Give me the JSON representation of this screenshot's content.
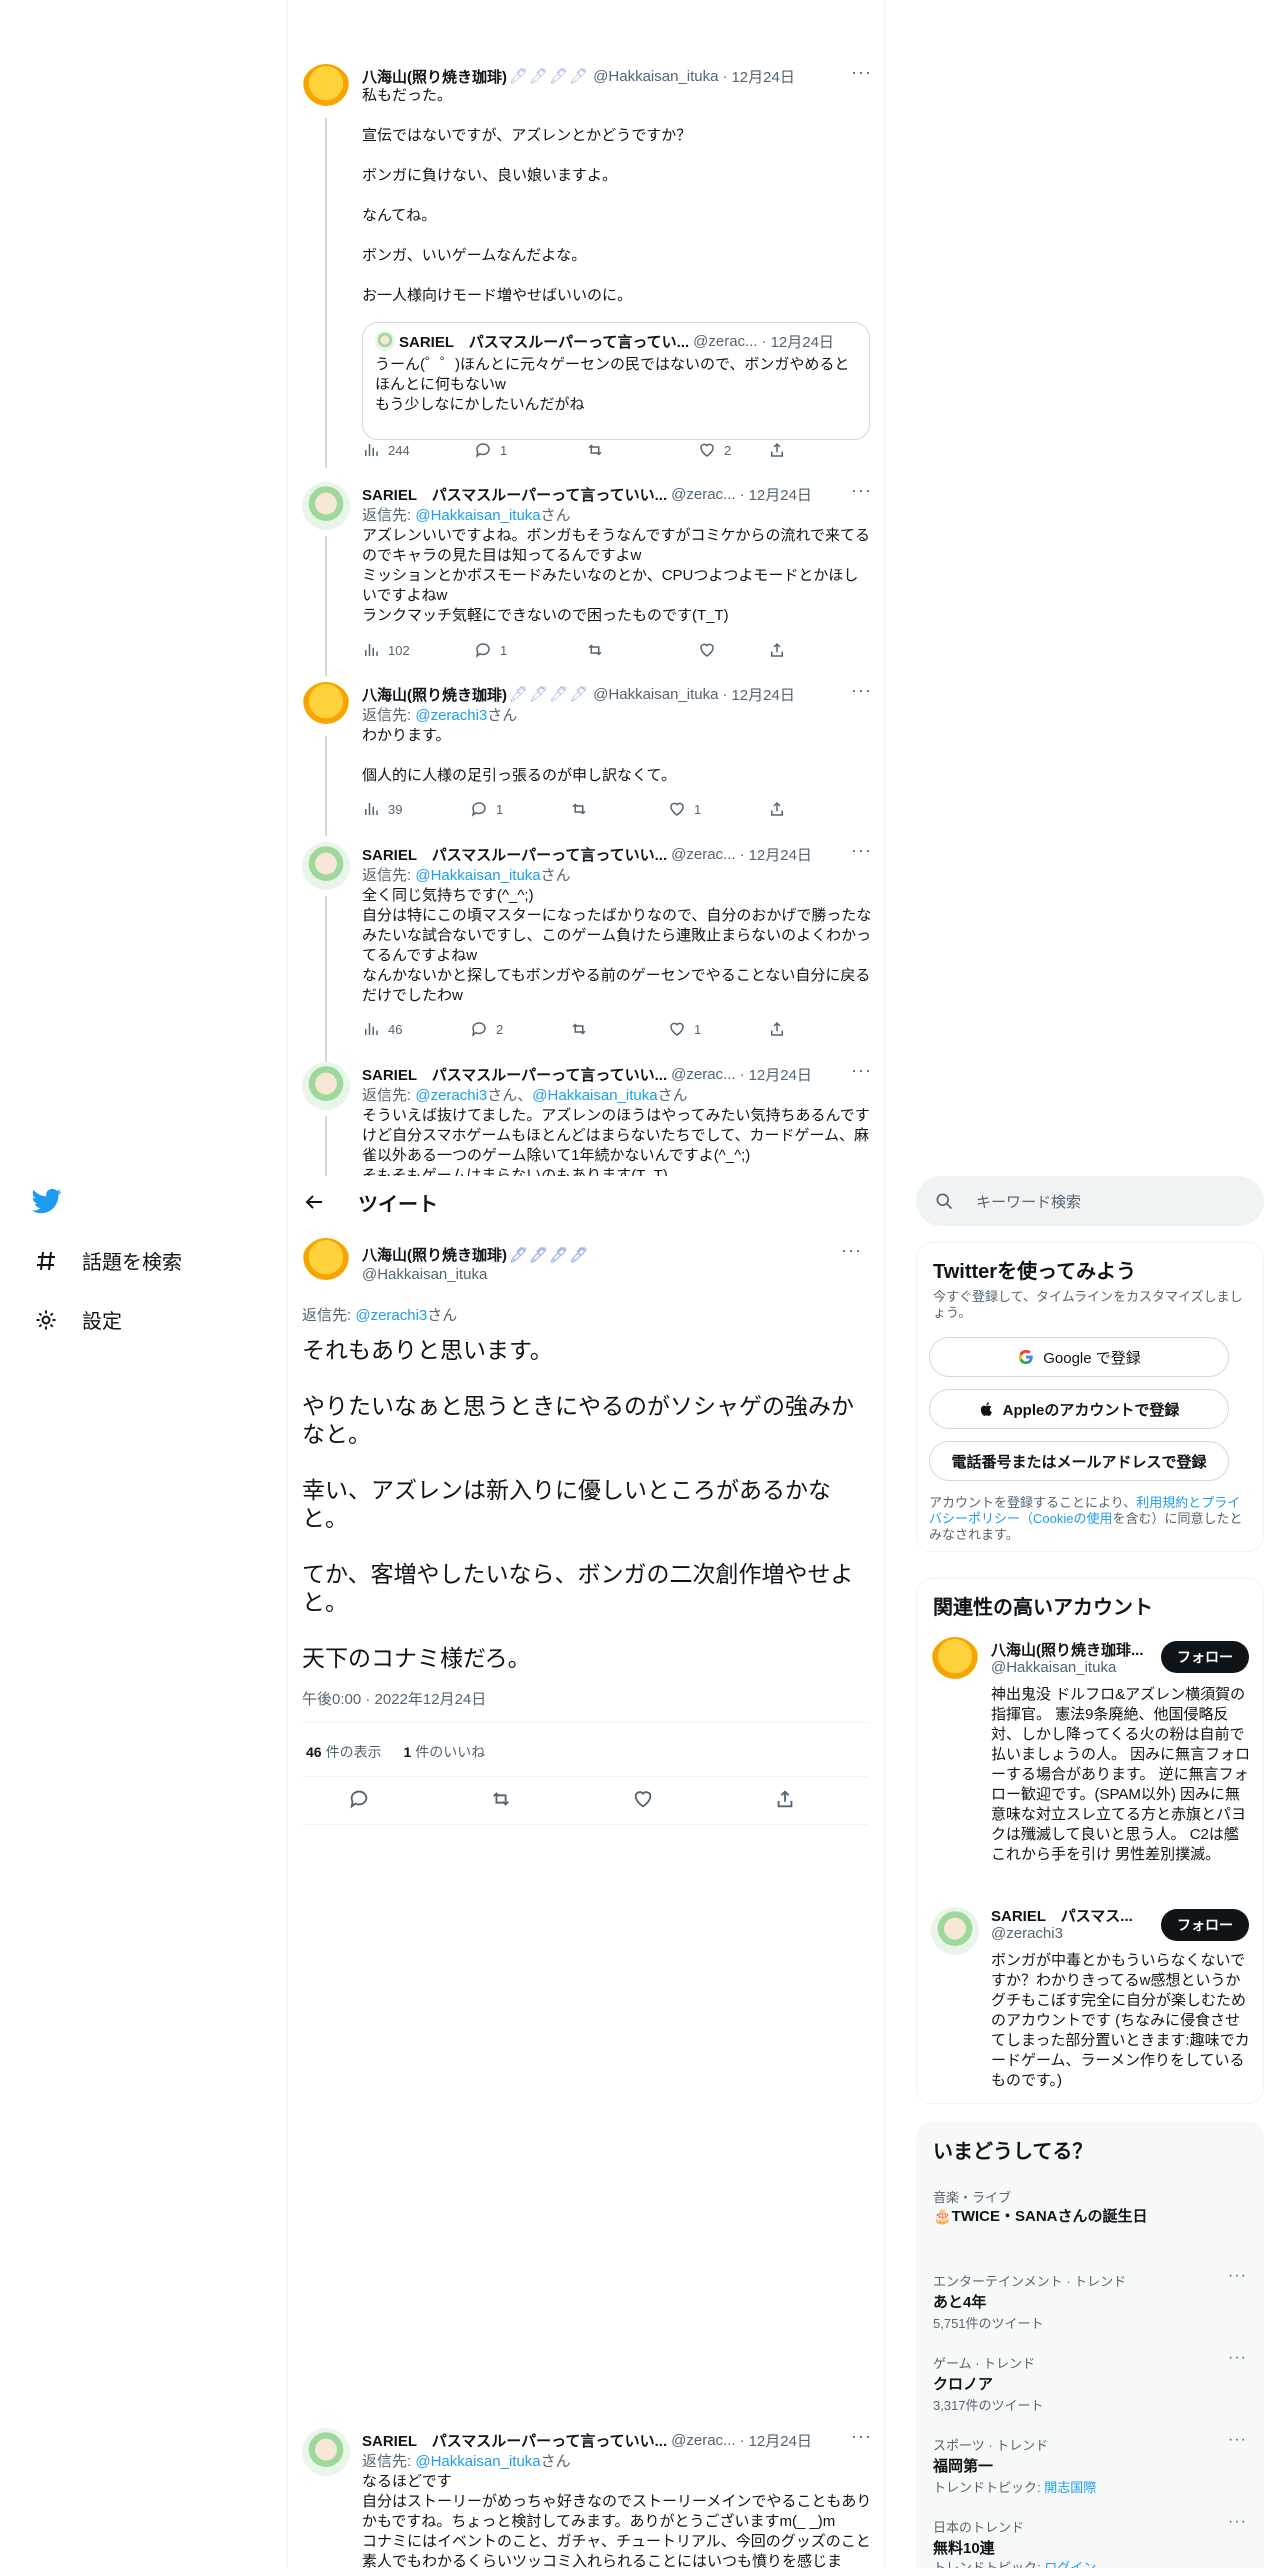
{
  "colors": {
    "accent": "#1d9bf0",
    "text": "#0f1419",
    "muted": "#536471",
    "border": "#eff3f4"
  },
  "nav": {
    "logo_icon": "twitter-bird-icon",
    "explore_label": "話題を検索",
    "settings_label": "設定"
  },
  "timeline": [
    {
      "name": "八海山(照り焼き珈琲)",
      "badges": "🖊🖊🖊🖊",
      "handle": "@Hakkaisan_ituka",
      "time": "12月24日",
      "text": "私もだった。\n\n宣伝ではないですが、アズレンとかどうですか？\n\nボンガに負けない、良い娘いますよ。\n\nなんてね。\n\nボンガ、いいゲームなんだよな。\n\nお一人様向けモード増やせばいいのに。",
      "quote": {
        "name": "SARIEL　パスマスルーパーって言ってい...",
        "handle": "@zerac...",
        "time": "12月24日",
        "text": "うーん(゜゜)ほんとに元々ゲーセンの民ではないので、ボンガやめるとほんとに何もないw\nもう少しなにかしたいんだがね"
      },
      "views": "244",
      "replies": "1",
      "retweets": "",
      "likes": "2"
    },
    {
      "name": "SARIEL　パスマスルーパーって言っていい...",
      "handle": "@zerac...",
      "time": "12月24日",
      "reply_prefix": "返信先: ",
      "reply_to": "@Hakkaisan_ituka",
      "reply_suffix": "さん",
      "text": "アズレンいいですよね。ボンガもそうなんですがコミケからの流れで来てるのでキャラの見た目は知ってるんですよw\nミッションとかボスモードみたいなのとか、CPUつよつよモードとかほしいですよねw\nランクマッチ気軽にできないので困ったものです(T_T)",
      "views": "102",
      "replies": "1",
      "retweets": "",
      "likes": ""
    },
    {
      "name": "八海山(照り焼き珈琲)",
      "badges": "🖊🖊🖊🖊",
      "handle": "@Hakkaisan_ituka",
      "time": "12月24日",
      "reply_prefix": "返信先: ",
      "reply_to": "@zerachi3",
      "reply_suffix": "さん",
      "text": "わかります。\n\n個人的に人様の足引っ張るのが申し訳なくて。",
      "views": "39",
      "replies": "1",
      "retweets": "",
      "likes": "1"
    },
    {
      "name": "SARIEL　パスマスルーパーって言っていい...",
      "handle": "@zerac...",
      "time": "12月24日",
      "reply_prefix": "返信先: ",
      "reply_to": "@Hakkaisan_ituka",
      "reply_suffix": "さん",
      "text": "全く同じ気持ちです(^_^;)\n自分は特にこの頃マスターになったばかりなので、自分のおかげで勝ったなみたいな試合ないですし、このゲーム負けたら連敗止まらないのよくわかってるんですよねw\nなんかないかと探してもボンガやる前のゲーセンでやることない自分に戻るだけでしたわw",
      "views": "46",
      "replies": "2",
      "retweets": "",
      "likes": "1"
    },
    {
      "name": "SARIEL　パスマスルーパーって言っていい...",
      "handle": "@zerac...",
      "time": "12月24日",
      "reply_prefix": "返信先: ",
      "reply_to": "@zerachi3",
      "reply_to2": "@Hakkaisan_ituka",
      "reply_mid": "さん、",
      "reply_suffix": "さん",
      "text": "そういえば抜けてました。アズレンのほうはやってみたい気持ちあるんですけど自分スマホゲームもほとんどはまらないたちでして、カードゲーム、麻雀以外ある一つのゲーム除いて1年続かないんですよ(^_^;)\nそもそもゲームはまらないのもあります(T_T)"
    }
  ],
  "detail": {
    "header_title": "ツイート",
    "name": "八海山(照り焼き珈琲)",
    "badges": "🖊🖊🖊🖊",
    "handle": "@Hakkaisan_ituka",
    "reply_prefix": "返信先: ",
    "reply_to": "@zerachi3",
    "reply_suffix": "さん",
    "text": "それもありと思います。\n\nやりたいなぁと思うときにやるのがソシャゲの強みかなと。\n\n幸い、アズレンは新入りに優しいところがあるかなと。\n\nてか、客増やしたいなら、ボンガの二次創作増やせよと。\n\n天下のコナミ様だろ。",
    "timestamp": "午後0:00 · 2022年12月24日",
    "views_count": "46",
    "views_label": "件の表示",
    "likes_count": "1",
    "likes_label": "件のいいね"
  },
  "reply_below": {
    "name": "SARIEL　パスマスルーパーって言っていい...",
    "handle": "@zerac...",
    "time": "12月24日",
    "reply_prefix": "返信先: ",
    "reply_to": "@Hakkaisan_ituka",
    "reply_suffix": "さん",
    "text": "なるほどです\n自分はストーリーがめっちゃ好きなのでストーリーメインでやることもありかもですね。ちょっと検討してみます。ありがとうございますm(_ _)m\nコナミにはイベントのこと、ガチャ、チュートリアル、今回のグッズのこと素人でもわかるくらいツッコミ入れられることにはいつも憤りを感じま"
  },
  "sidebar": {
    "search_placeholder": "キーワード検索",
    "signup": {
      "title": "Twitterを使ってみよう",
      "subtitle": "今すぐ登録して、タイムラインをカスタマイズしましょう。",
      "google_label": "Google で登録",
      "apple_label": "Appleのアカウントで登録",
      "phone_label": "電話番号またはメールアドレスで登録",
      "terms_prefix": "アカウントを登録することにより、",
      "terms_link": "利用規約とプライバシーポリシー（Cookieの使用",
      "terms_suffix": "を含む）に同意したとみなされます。"
    },
    "related": {
      "title": "関連性の高いアカウント",
      "follow_label": "フォロー",
      "accounts": [
        {
          "name": "八海山(照り焼き珈琲...",
          "handle": "@Hakkaisan_ituka",
          "bio": "神出鬼没 ドルフロ&アズレン横須賀の指揮官。 憲法9条廃絶、他国侵略反対、しかし降ってくる火の粉は自前で払いましょうの人。 因みに無言フォローする場合があります。 逆に無言フォロー歓迎です。(SPAM以外) 因みに無意味な対立スレ立てる方と赤旗とパヨクは殲滅して良いと思う人。 C2は艦これから手を引け 男性差別撲滅。"
        },
        {
          "name": "SARIEL　パスマス...",
          "handle": "@zerachi3",
          "bio": "ボンガが中毒とかもういらなくないですか？わかりきってるw感想というかグチもこぼす完全に自分が楽しむためのアカウントです (ちなみに侵食させてしまった部分置いときます:趣味でカードゲーム、ラーメン作りをしているものです。)"
        }
      ]
    },
    "trends": {
      "title": "いまどうしてる？",
      "items": [
        {
          "category": "音楽・ライブ",
          "name": "🎂TWICE・SANAさんの誕生日",
          "count": ""
        },
        {
          "category": "エンターテインメント · トレンド",
          "name": "あと4年",
          "count": "5,751件のツイート"
        },
        {
          "category": "ゲーム · トレンド",
          "name": "クロノア",
          "count": "3,317件のツイート"
        },
        {
          "category": "スポーツ · トレンド",
          "name": "福岡第一",
          "count_prefix": "トレンドトピック: ",
          "count_link": "開志国際"
        },
        {
          "category": "日本のトレンド",
          "name": "無料10連",
          "count_prefix": "トレンドトピック: ",
          "count_link": "ログイン"
        }
      ]
    }
  }
}
